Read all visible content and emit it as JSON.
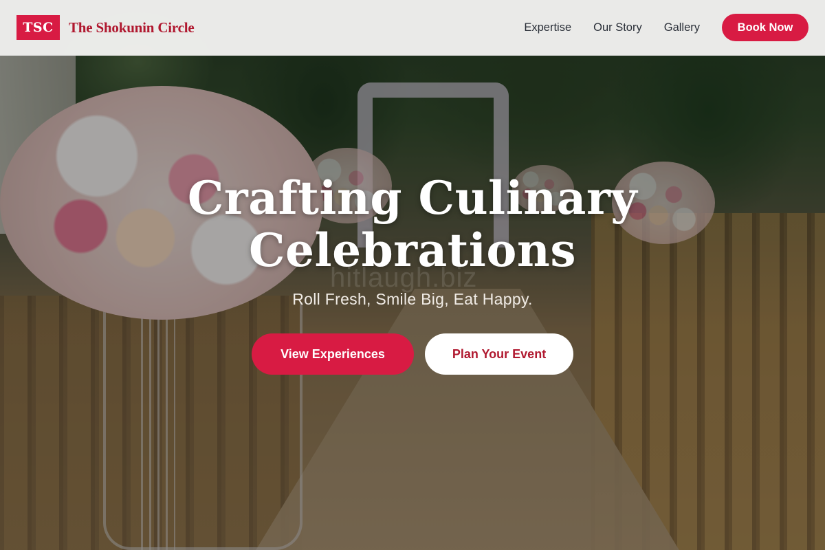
{
  "brand": {
    "logo_text": "TSC",
    "name": "The Shokunin Circle"
  },
  "nav": {
    "links": [
      {
        "label": "Expertise"
      },
      {
        "label": "Our Story"
      },
      {
        "label": "Gallery"
      }
    ],
    "cta_label": "Book Now"
  },
  "hero": {
    "title": "Crafting Culinary Celebrations",
    "subtitle": "Roll Fresh, Smile Big, Eat Happy.",
    "watermark": "hitlaugh.biz",
    "primary_action": "View Experiences",
    "secondary_action": "Plan Your Event",
    "background_description_icon": "wedding-aisle-photo"
  },
  "colors": {
    "accent": "#d81b43",
    "brand_text": "#b0182f",
    "nav_text": "#2a2f38",
    "header_bg": "#f2f2f0"
  }
}
